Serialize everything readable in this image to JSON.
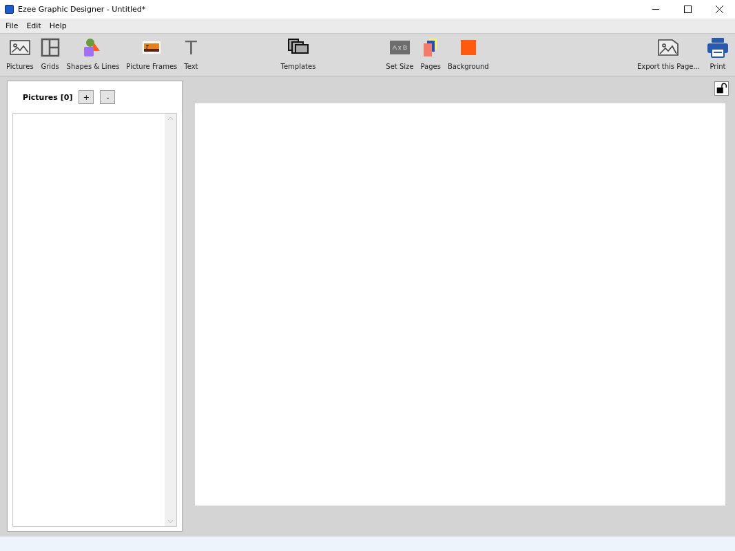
{
  "window": {
    "title": "Ezee Graphic Designer - Untitled*"
  },
  "menu": [
    "File",
    "Edit",
    "Help"
  ],
  "toolbar_groups": [
    [
      {
        "kind": "pictures",
        "label": "Pictures"
      },
      {
        "kind": "grids",
        "label": "Grids"
      },
      {
        "kind": "shapes",
        "label": "Shapes & Lines"
      },
      {
        "kind": "frames",
        "label": "Picture Frames"
      },
      {
        "kind": "text",
        "label": "Text",
        "glyph": "T"
      }
    ],
    [
      {
        "kind": "templates",
        "label": "Templates"
      }
    ],
    [
      {
        "kind": "size",
        "label": "Set Size",
        "glyph": "A x B"
      },
      {
        "kind": "pages",
        "label": "Pages"
      },
      {
        "kind": "background",
        "label": "Background"
      }
    ],
    [
      {
        "kind": "export",
        "label": "Export this Page..."
      },
      {
        "kind": "print",
        "label": "Print"
      }
    ]
  ],
  "pictures_panel": {
    "title": "Pictures [0]",
    "buttons": [
      "+",
      "-"
    ]
  }
}
